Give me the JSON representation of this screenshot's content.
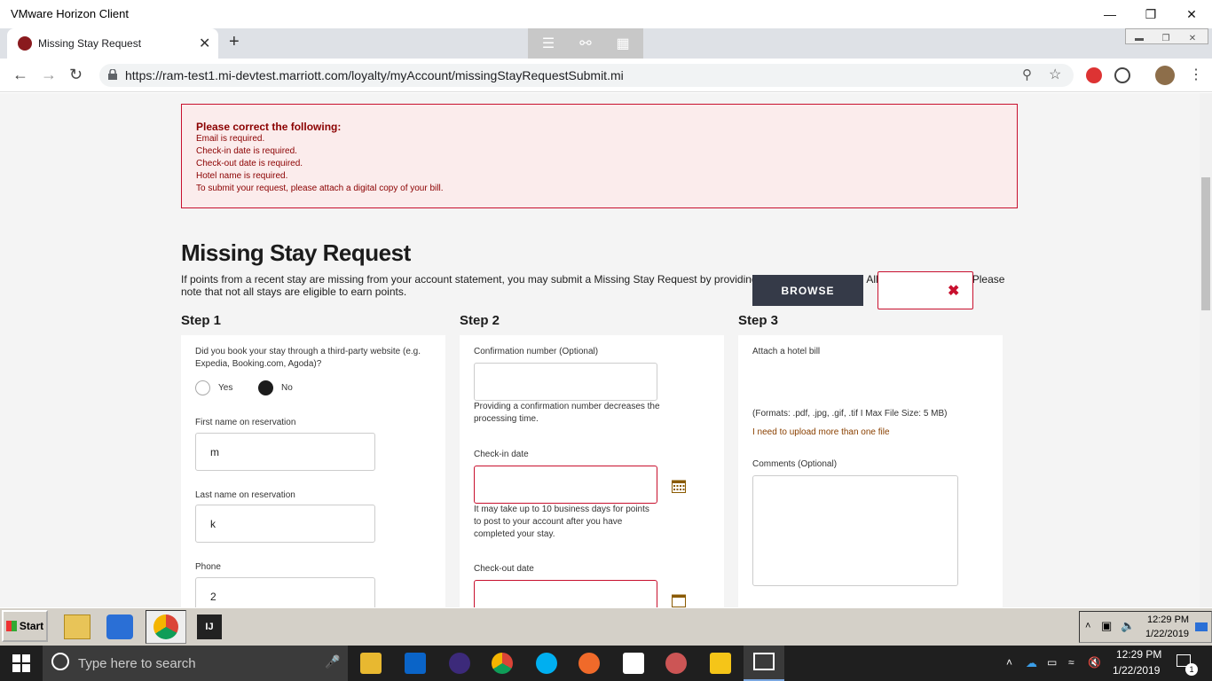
{
  "window": {
    "title": "VMware Horizon Client"
  },
  "browser": {
    "tab_title": "Missing Stay Request",
    "url": "https://ram-test1.mi-devtest.marriott.com/loyalty/myAccount/missingStayRequestSubmit.mi"
  },
  "errors": {
    "heading": "Please correct the following:",
    "items": [
      "Email is required.",
      "Check-in date is required.",
      "Check-out date is required.",
      "Hotel name is required.",
      "To submit your request, please attach a digital copy of your bill."
    ]
  },
  "page": {
    "title": "Missing Stay Request",
    "desc": "If points from a recent stay are missing from your account statement, you may submit a Missing Stay Request by providing the information below. All fields are required. Please note that not all stays are eligible to earn points."
  },
  "step1": {
    "heading": "Step 1",
    "question": "Did you book your stay through a third-party website (e.g. Expedia, Booking.com, Agoda)?",
    "yes": "Yes",
    "no": "No",
    "selected": "No",
    "first_label": "First name on reservation",
    "first_value": "m",
    "last_label": "Last name on reservation",
    "last_value": "k",
    "phone_label": "Phone",
    "phone_value": "2"
  },
  "step2": {
    "heading": "Step 2",
    "conf_label": "Confirmation number (Optional)",
    "conf_help": "Providing a confirmation number decreases the processing time.",
    "checkin_label": "Check-in date",
    "checkin_help": "It may take up to 10 business days for points to post to your account after you have completed your stay.",
    "checkout_label": "Check-out date"
  },
  "step3": {
    "heading": "Step 3",
    "attach_label": "Attach a hotel bill",
    "browse": "BROWSE",
    "formats": "(Formats: .pdf, .jpg, .gif, .tif I Max File Size: 5 MB)",
    "more_link": "I need to upload more than one file",
    "comments_label": "Comments (Optional)"
  },
  "vm_taskbar": {
    "start": "Start",
    "time": "12:29 PM",
    "date": "1/22/2019"
  },
  "win_taskbar": {
    "search_placeholder": "Type here to search",
    "time": "12:29 PM",
    "date": "1/22/2019",
    "notif_count": "1"
  }
}
